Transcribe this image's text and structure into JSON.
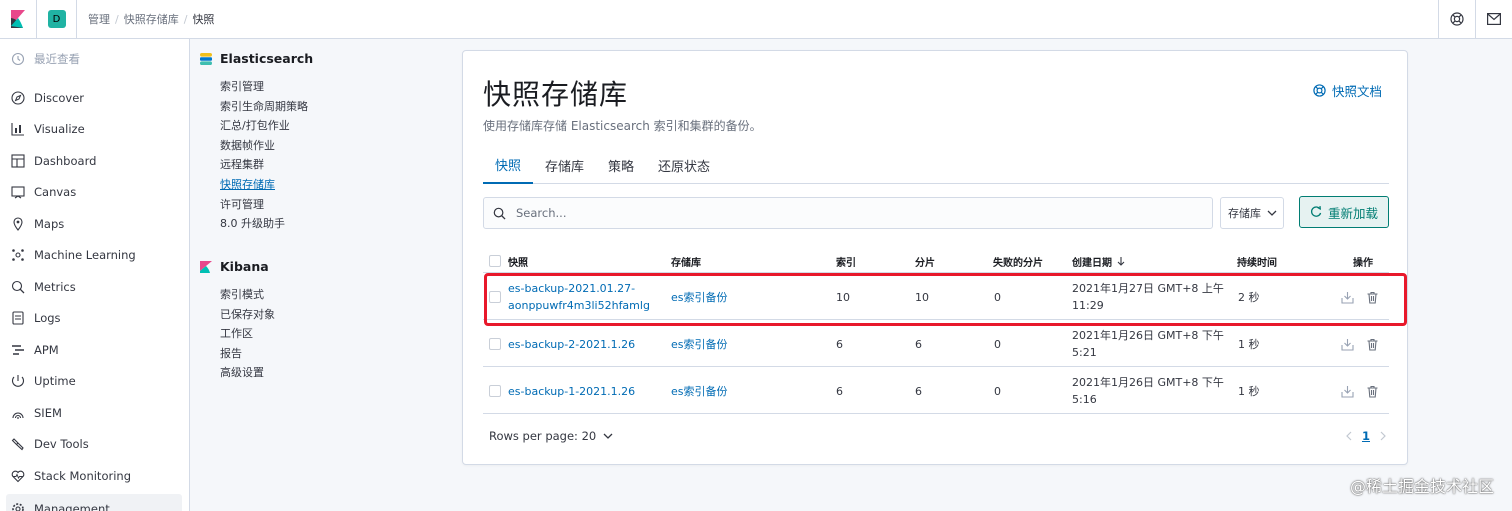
{
  "header": {
    "space_initial": "D",
    "breadcrumbs": [
      "管理",
      "快照存储库",
      "快照"
    ]
  },
  "nav": {
    "recent": "最近查看",
    "items": [
      "Discover",
      "Visualize",
      "Dashboard",
      "Canvas",
      "Maps",
      "Machine Learning",
      "Metrics",
      "Logs",
      "APM",
      "Uptime",
      "SIEM",
      "Dev Tools",
      "Stack Monitoring",
      "Management"
    ]
  },
  "subnav": {
    "es_title": "Elasticsearch",
    "es_links": [
      "索引管理",
      "索引生命周期策略",
      "汇总/打包作业",
      "数据帧作业",
      "远程集群",
      "快照存储库",
      "许可管理",
      "8.0 升级助手"
    ],
    "kibana_title": "Kibana",
    "kibana_links": [
      "索引模式",
      "已保存对象",
      "工作区",
      "报告",
      "高级设置"
    ]
  },
  "panel": {
    "title": "快照存储库",
    "description": "使用存储库存储 Elasticsearch 索引和集群的备份。",
    "docs_link": "快照文档",
    "tabs": [
      "快照",
      "存储库",
      "策略",
      "还原状态"
    ],
    "search_placeholder": "Search...",
    "repo_filter": "存储库",
    "reload_button": "重新加载"
  },
  "table": {
    "columns": [
      "快照",
      "存储库",
      "索引",
      "分片",
      "失败的分片",
      "创建日期",
      "持续时间",
      "操作"
    ],
    "rows": [
      {
        "snapshot_line1": "es-backup-2021.01.27-",
        "snapshot_line2": "aonppuwfr4m3li52hfamlg",
        "repository": "es索引备份",
        "indices": "10",
        "shards": "10",
        "failed": "0",
        "date_line1": "2021年1月27日 GMT+8 上午",
        "date_line2": "11:29",
        "duration": "2 秒"
      },
      {
        "snapshot_line1": "es-backup-2-2021.1.26",
        "snapshot_line2": "",
        "repository": "es索引备份",
        "indices": "6",
        "shards": "6",
        "failed": "0",
        "date_line1": "2021年1月26日 GMT+8 下午",
        "date_line2": "5:21",
        "duration": "1 秒"
      },
      {
        "snapshot_line1": "es-backup-1-2021.1.26",
        "snapshot_line2": "",
        "repository": "es索引备份",
        "indices": "6",
        "shards": "6",
        "failed": "0",
        "date_line1": "2021年1月26日 GMT+8 下午",
        "date_line2": "5:16",
        "duration": "1 秒"
      }
    ]
  },
  "pagination": {
    "rows_per_page": "Rows per page: 20",
    "current_page": "1"
  },
  "watermark": "@稀土掘金技术社区",
  "colors": {
    "link": "#006bb4",
    "accent": "#017d73",
    "highlight": "#e8182b"
  }
}
